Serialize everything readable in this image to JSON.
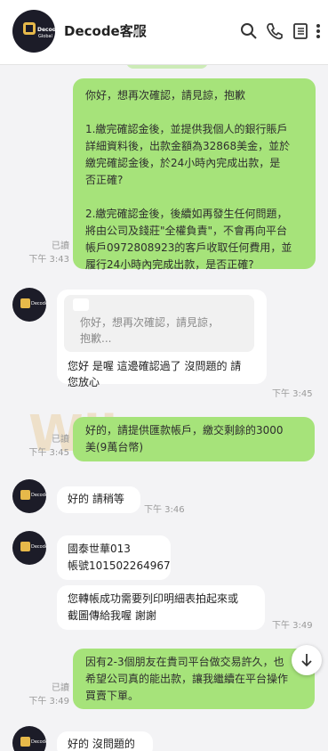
{
  "header": {
    "title": "Decode客服",
    "avatar_text": "Decode Global"
  },
  "messages": {
    "m1": {
      "lines": [
        "你好，想再次確認，請見諒，抱歉",
        "",
        "1.繳完確認金後，並提供我個人的銀行賬戶",
        "詳細資料後，出款金額為32868美金，並於",
        "繳完確認金後，於24小時內完成出款，是",
        "否正確?",
        "",
        "2.繳完確認金後，後續如再發生任何問題，",
        "將由公司及錢莊\"全權負責\"，不會再向平台",
        "帳戶0972808923的客戶收取任何費用，並",
        "履行24小時內完成出款，是否正確?"
      ],
      "read": "已讀",
      "time": "下午 3:43"
    },
    "m2": {
      "quote_lines": [
        "你好，想再次確認，請見諒，",
        "抱歉..."
      ],
      "lines": [
        "您好 是喔 這邊確認過了 沒問題的 請",
        "您放心"
      ],
      "time": "下午 3:45"
    },
    "m3": {
      "lines": [
        "好的，請提供匯款帳戶，繳交剩餘的3000",
        "美(9萬台幣)"
      ],
      "read": "已讀",
      "time": "下午 3:45"
    },
    "m4": {
      "text": "好的 請稍等",
      "time": "下午 3:46"
    },
    "m5": {
      "lines": [
        "國泰世華013",
        "帳號101502264967"
      ]
    },
    "m6": {
      "lines": [
        "您轉帳成功需要列印明細表拍起來或",
        "截圖傳給我喔 謝謝"
      ],
      "time": "下午 3:49"
    },
    "m7": {
      "lines": [
        "因有2-3個朋友在貴司平台做交易許久，也",
        "希望公司真的能出款，讓我繼續在平台操作",
        "買賣下單。"
      ],
      "read": "已讀",
      "time": "下午 3:49"
    },
    "m8": {
      "text": "好的 沒問題的"
    }
  },
  "watermark": "Wik",
  "icons": [
    "search-icon",
    "phone-icon",
    "notes-icon",
    "more-icon",
    "mute-icon",
    "scroll-down-icon"
  ]
}
